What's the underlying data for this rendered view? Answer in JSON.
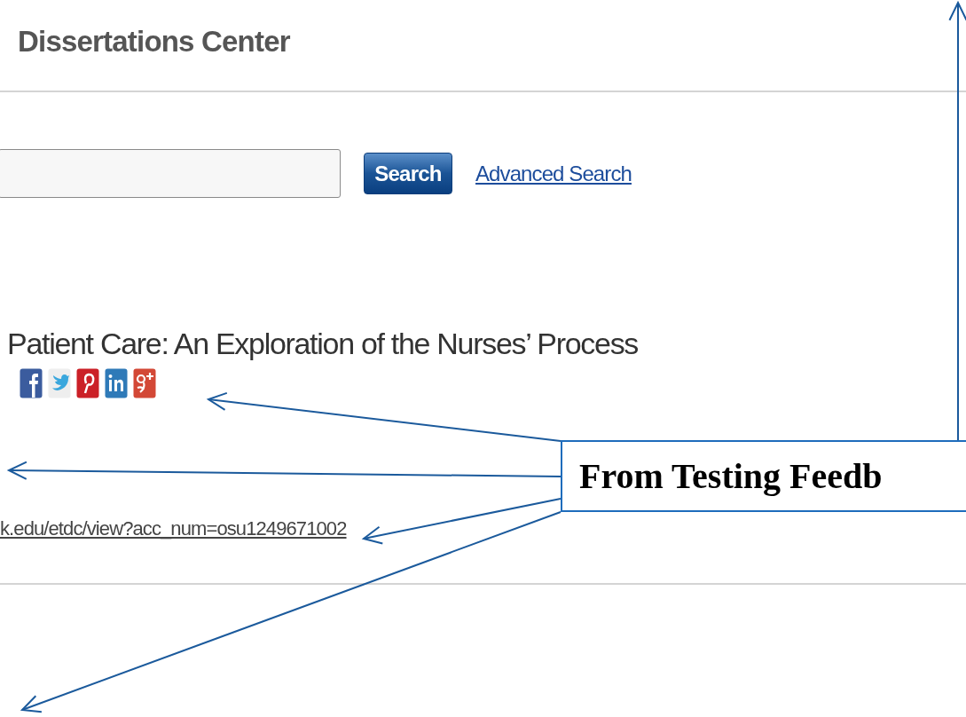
{
  "header": {
    "title": "Dissertations Center"
  },
  "search": {
    "button": "Search",
    "advanced_link": "Advanced Search"
  },
  "record": {
    "title": "Patient Care: An Exploration of the Nurses’ Process",
    "share_icons": [
      {
        "kind": "facebook"
      },
      {
        "kind": "twitter"
      },
      {
        "kind": "pinterest"
      },
      {
        "kind": "linkedin"
      },
      {
        "kind": "googleplus"
      }
    ],
    "url": "k.edu/etdc/view?acc_num=osu1249671002"
  },
  "callout": {
    "text": "From Testing Feedb"
  }
}
